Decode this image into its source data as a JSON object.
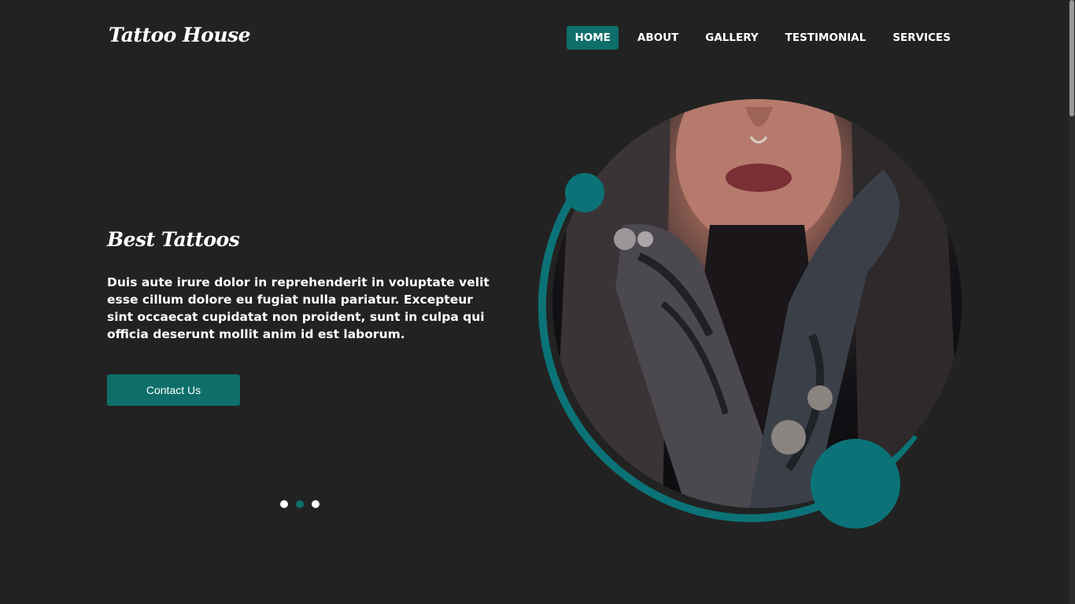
{
  "brand": {
    "name": "Tattoo House"
  },
  "nav": {
    "items": [
      {
        "label": "HOME",
        "active": true
      },
      {
        "label": "ABOUT",
        "active": false
      },
      {
        "label": "GALLERY",
        "active": false
      },
      {
        "label": "TESTIMONIAL",
        "active": false
      },
      {
        "label": "SERVICES",
        "active": false
      }
    ]
  },
  "hero": {
    "title": "Best Tattoos",
    "text": "Duis aute irure dolor in reprehenderit in voluptate velit esse cillum dolore eu fugiat nulla pariatur. Excepteur sint occaecat cupidatat non proident, sunt in culpa qui officia deserunt mollit anim id est laborum.",
    "button_label": "Contact Us",
    "slider": {
      "count": 3,
      "active_index": 1
    }
  },
  "colors": {
    "accent": "#0e6f6a",
    "ring": "#0b7377",
    "background": "#222222",
    "text": "#ffffff"
  }
}
